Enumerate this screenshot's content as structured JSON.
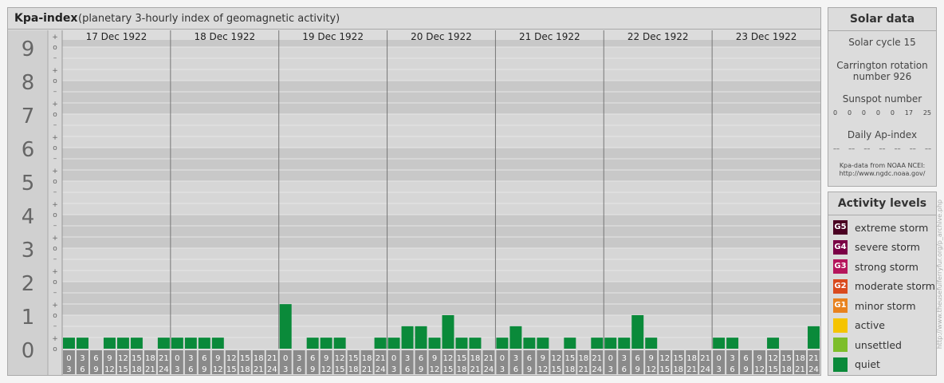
{
  "header": {
    "title": "Kpa-index",
    "subtitle": "(planetary 3-hourly index of geomagnetic activity)"
  },
  "chart_data": {
    "type": "bar",
    "title": "Kpa-index",
    "subtitle": "(planetary 3-hourly index of geomagnetic activity)",
    "ylim": [
      0,
      9
    ],
    "y_ticks": [
      "0",
      "1",
      "2",
      "3",
      "4",
      "5",
      "6",
      "7",
      "8",
      "9"
    ],
    "sub_ticks": [
      "+",
      "o",
      "–"
    ],
    "days": [
      "17 Dec 1922",
      "18 Dec 1922",
      "19 Dec 1922",
      "20 Dec 1922",
      "21 Dec 1922",
      "22 Dec 1922",
      "23 Dec 1922"
    ],
    "slot_top": [
      "0",
      "3",
      "6",
      "9",
      "12",
      "15",
      "18",
      "21"
    ],
    "slot_bottom": [
      "3",
      "6",
      "9",
      "12",
      "15",
      "18",
      "21",
      "24"
    ],
    "series": [
      {
        "color": "#0a8a3a",
        "values": [
          0.33,
          0.33,
          0,
          0.33,
          0.33,
          0.33,
          0,
          0.33,
          0.33,
          0.33,
          0.33,
          0.33,
          0,
          0,
          0,
          0,
          1.33,
          0,
          0.33,
          0.33,
          0.33,
          0,
          0,
          0.33,
          0.33,
          0.67,
          0.67,
          0.33,
          1,
          0.33,
          0.33,
          0,
          0.33,
          0.67,
          0.33,
          0.33,
          0,
          0.33,
          0,
          0.33,
          0.33,
          0.33,
          1,
          0.33,
          0,
          0,
          0,
          0,
          0.33,
          0.33,
          0,
          0,
          0.33,
          0,
          0,
          0.67
        ]
      }
    ]
  },
  "solar": {
    "title": "Solar data",
    "cycle": "Solar cycle 15",
    "carrington_1": "Carrington rotation",
    "carrington_2": "number 926",
    "sunspot_label": "Sunspot number",
    "sunspot_values": [
      "0",
      "0",
      "0",
      "0",
      "0",
      "17",
      "25"
    ],
    "ap_label": "Daily Ap-index",
    "ap_values": [
      "––",
      "––",
      "––",
      "––",
      "––",
      "––",
      "––"
    ],
    "source_1": "Kpa-data from NOAA NCEI:",
    "source_2": "http://www.ngdc.noaa.gov/"
  },
  "levels": {
    "title": "Activity levels",
    "items": [
      {
        "badge": "G5",
        "label": "extreme storm",
        "color": "#4a0022"
      },
      {
        "badge": "G4",
        "label": "severe storm",
        "color": "#7a0045"
      },
      {
        "badge": "G3",
        "label": "strong storm",
        "color": "#b5155c"
      },
      {
        "badge": "G2",
        "label": "moderate storm",
        "color": "#d94a1e"
      },
      {
        "badge": "G1",
        "label": "minor storm",
        "color": "#e8821e"
      },
      {
        "badge": "",
        "label": "active",
        "color": "#f5c400"
      },
      {
        "badge": "",
        "label": "unsettled",
        "color": "#7dbe2a"
      },
      {
        "badge": "",
        "label": "quiet",
        "color": "#0a8a3a"
      }
    ]
  },
  "side_text": "http://www.theusefulferryfur.org/p_archive.php"
}
